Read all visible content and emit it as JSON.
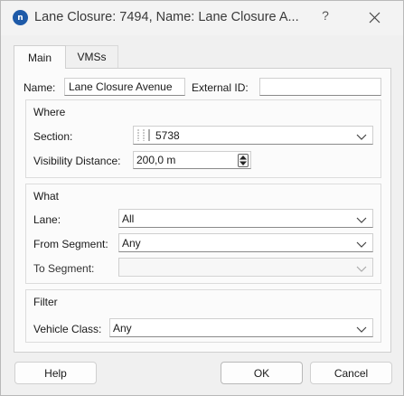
{
  "window": {
    "title": "Lane Closure: 7494, Name: Lane Closure A...",
    "app_icon_text": "n",
    "help_glyph": "?",
    "close_icon": "close-icon"
  },
  "tabs": [
    {
      "label": "Main",
      "active": true
    },
    {
      "label": "VMSs",
      "active": false
    }
  ],
  "main": {
    "name_label": "Name:",
    "name_value": "Lane Closure Avenue",
    "external_id_label": "External ID:",
    "external_id_value": ""
  },
  "where": {
    "title": "Where",
    "section_label": "Section:",
    "section_value": "5738",
    "visibility_label": "Visibility Distance:",
    "visibility_value": "200,0 m"
  },
  "what": {
    "title": "What",
    "lane_label": "Lane:",
    "lane_value": "All",
    "from_segment_label": "From Segment:",
    "from_segment_value": "Any",
    "to_segment_label": "To Segment:",
    "to_segment_value": ""
  },
  "filter": {
    "title": "Filter",
    "vehicle_class_label": "Vehicle Class:",
    "vehicle_class_value": "Any"
  },
  "buttons": {
    "help": "Help",
    "ok": "OK",
    "cancel": "Cancel"
  },
  "colors": {
    "dialog_bg": "#f0f0f0",
    "panel_bg": "#fbfbfb",
    "app_icon": "#1e5aa8"
  }
}
